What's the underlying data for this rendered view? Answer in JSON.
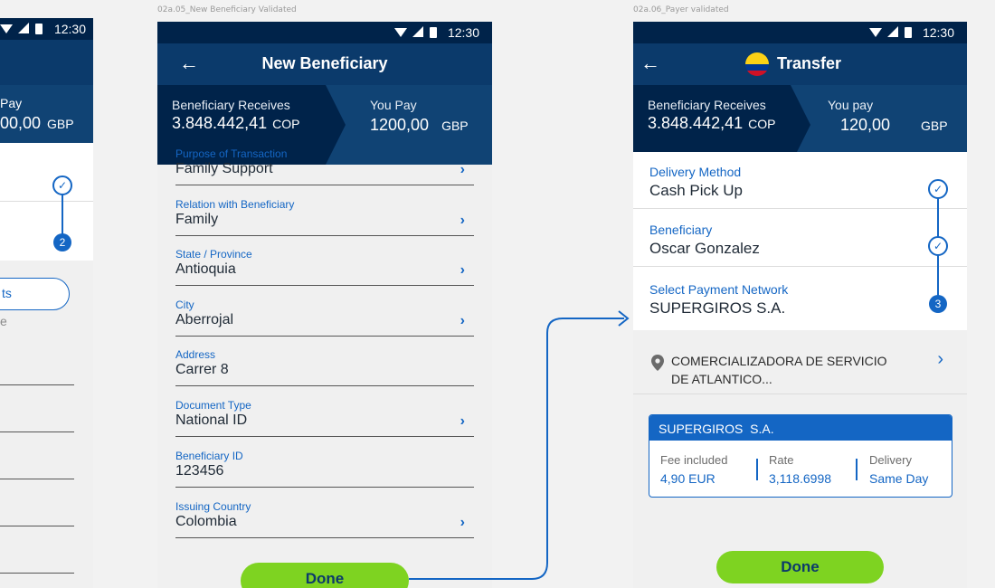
{
  "frames": {
    "middle_label": "02a.05_New Beneficiary Validated",
    "right_label": "02a.06_Payer validated"
  },
  "status": {
    "time": "12:30"
  },
  "left_phone": {
    "you_pay_label": "Pay",
    "amount": "00,00",
    "currency": "GBP",
    "step_number": "2",
    "button_fragment": "ts",
    "text_fragment": "e"
  },
  "new_beneficiary": {
    "title": "New Beneficiary",
    "receives_label": "Beneficiary Receives",
    "receives_amount": "3.848.442,41",
    "receives_currency": "COP",
    "pay_label": "You Pay",
    "pay_amount": "1200,00",
    "pay_currency": "GBP",
    "fields": [
      {
        "label": "Purpose of Transaction",
        "value": "Family Support",
        "chevron": true
      },
      {
        "label": "Relation with Beneficiary",
        "value": "Family",
        "chevron": true
      },
      {
        "label": "State / Province",
        "value": "Antioquia",
        "chevron": true
      },
      {
        "label": "City",
        "value": "Aberrojal",
        "chevron": true
      },
      {
        "label": "Address",
        "value": "Carrer 8",
        "chevron": false
      },
      {
        "label": "Document Type",
        "value": "National ID",
        "chevron": true
      },
      {
        "label": "Beneficiary ID",
        "value": "123456",
        "chevron": false
      },
      {
        "label": "Issuing Country",
        "value": "Colombia",
        "chevron": true
      }
    ],
    "done_label": "Done"
  },
  "transfer": {
    "title": "Transfer",
    "receives_label": "Beneficiary Receives",
    "receives_amount": "3.848.442,41",
    "receives_currency": "COP",
    "pay_label": "You pay",
    "pay_amount": "120,00",
    "pay_currency": "GBP",
    "steps": [
      {
        "label": "Delivery Method",
        "value": "Cash Pick Up"
      },
      {
        "label": "Beneficiary",
        "value": "Oscar Gonzalez"
      },
      {
        "label": "Select Payment Network",
        "value": "SUPERGIROS S.A.",
        "number": "3"
      }
    ],
    "location_line1": "COMERCIALIZADORA DE SERVICIO",
    "location_line2": "DE ATLANTICO...",
    "card": {
      "title": "SUPERGIROS  S.A.",
      "fee_label": "Fee included",
      "fee_value": "4,90 EUR",
      "rate_label": "Rate",
      "rate_value": "3,118.6998",
      "delivery_label": "Delivery",
      "delivery_value": "Same Day"
    },
    "done_label": "Done"
  },
  "colors": {
    "primary": "#0b3a6b",
    "accent": "#1466c4",
    "done": "#7ed321"
  }
}
